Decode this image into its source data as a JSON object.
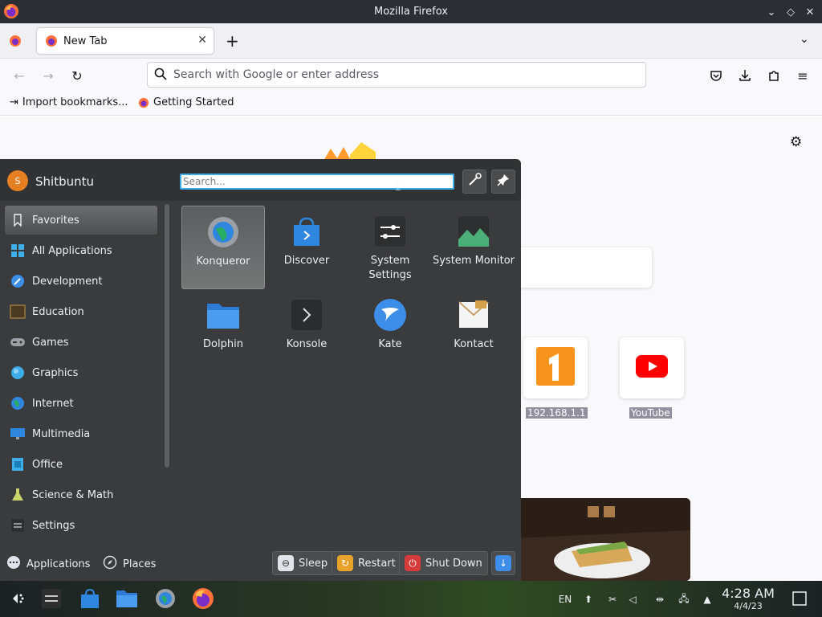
{
  "window": {
    "title": "Mozilla Firefox"
  },
  "tabs": [
    {
      "label": "New Tab"
    }
  ],
  "urlbar": {
    "placeholder": "Search with Google or enter address"
  },
  "bookmarks": [
    {
      "label": "Import bookmarks..."
    },
    {
      "label": "Getting Started"
    }
  ],
  "new_tab": {
    "shortcuts": [
      {
        "label": "192.168.1.1"
      },
      {
        "label": "YouTube"
      }
    ]
  },
  "launcher": {
    "username": "Shitbuntu",
    "avatar_letter": "S",
    "search_placeholder": "Search...",
    "categories": [
      {
        "label": "Favorites",
        "icon": "bookmark-icon"
      },
      {
        "label": "All Applications",
        "icon": "grid-icon"
      },
      {
        "label": "Development",
        "icon": "development-icon"
      },
      {
        "label": "Education",
        "icon": "education-icon"
      },
      {
        "label": "Games",
        "icon": "gamepad-icon"
      },
      {
        "label": "Graphics",
        "icon": "graphics-icon"
      },
      {
        "label": "Internet",
        "icon": "globe-icon"
      },
      {
        "label": "Multimedia",
        "icon": "monitor-icon"
      },
      {
        "label": "Office",
        "icon": "office-icon"
      },
      {
        "label": "Science & Math",
        "icon": "flask-icon"
      },
      {
        "label": "Settings",
        "icon": "settings-sliders-icon"
      }
    ],
    "apps": [
      {
        "label": "Konqueror",
        "icon": "konqueror-icon"
      },
      {
        "label": "Discover",
        "icon": "discover-icon"
      },
      {
        "label": "System Settings",
        "icon": "system-settings-icon"
      },
      {
        "label": "System Monitor",
        "icon": "system-monitor-icon"
      },
      {
        "label": "Dolphin",
        "icon": "folder-icon"
      },
      {
        "label": "Konsole",
        "icon": "terminal-icon"
      },
      {
        "label": "Kate",
        "icon": "kate-icon"
      },
      {
        "label": "Kontact",
        "icon": "kontact-icon"
      }
    ],
    "footer": {
      "applications": "Applications",
      "places": "Places",
      "sleep": "Sleep",
      "restart": "Restart",
      "shutdown": "Shut Down"
    }
  },
  "taskbar": {
    "language": "EN",
    "time": "4:28 AM",
    "date": "4/4/23"
  },
  "colors": {
    "accent": "#3daee9",
    "panel_bg": "#3a3b3c",
    "shutdown_red": "#d63c3c",
    "restart_orange": "#e8a42a"
  }
}
